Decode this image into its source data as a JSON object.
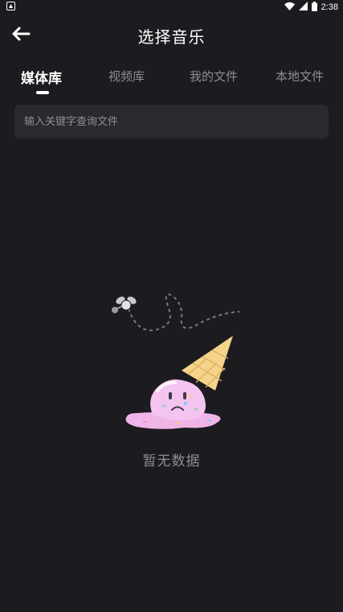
{
  "status_bar": {
    "time": "2:38",
    "icons": [
      "notification-icon",
      "wifi-icon",
      "signal-icon",
      "battery-icon"
    ]
  },
  "header": {
    "back_icon": "arrow-left-icon",
    "title": "选择音乐"
  },
  "tabs": [
    {
      "label": "媒体库",
      "active": true
    },
    {
      "label": "视频库",
      "active": false
    },
    {
      "label": "我的文件",
      "active": false
    },
    {
      "label": "本地文件",
      "active": false
    }
  ],
  "search": {
    "placeholder": "输入关键字查询文件",
    "value": ""
  },
  "empty_state": {
    "illustration": "melted-ice-cream-illustration",
    "message": "暂无数据"
  },
  "colors": {
    "background": "#1c1b1f",
    "search_background": "#2a292e",
    "text_primary": "#ffffff",
    "text_secondary": "#8e8d92",
    "ice_cream_pink": "#f0b4e8",
    "cone_yellow": "#f5d48a"
  }
}
